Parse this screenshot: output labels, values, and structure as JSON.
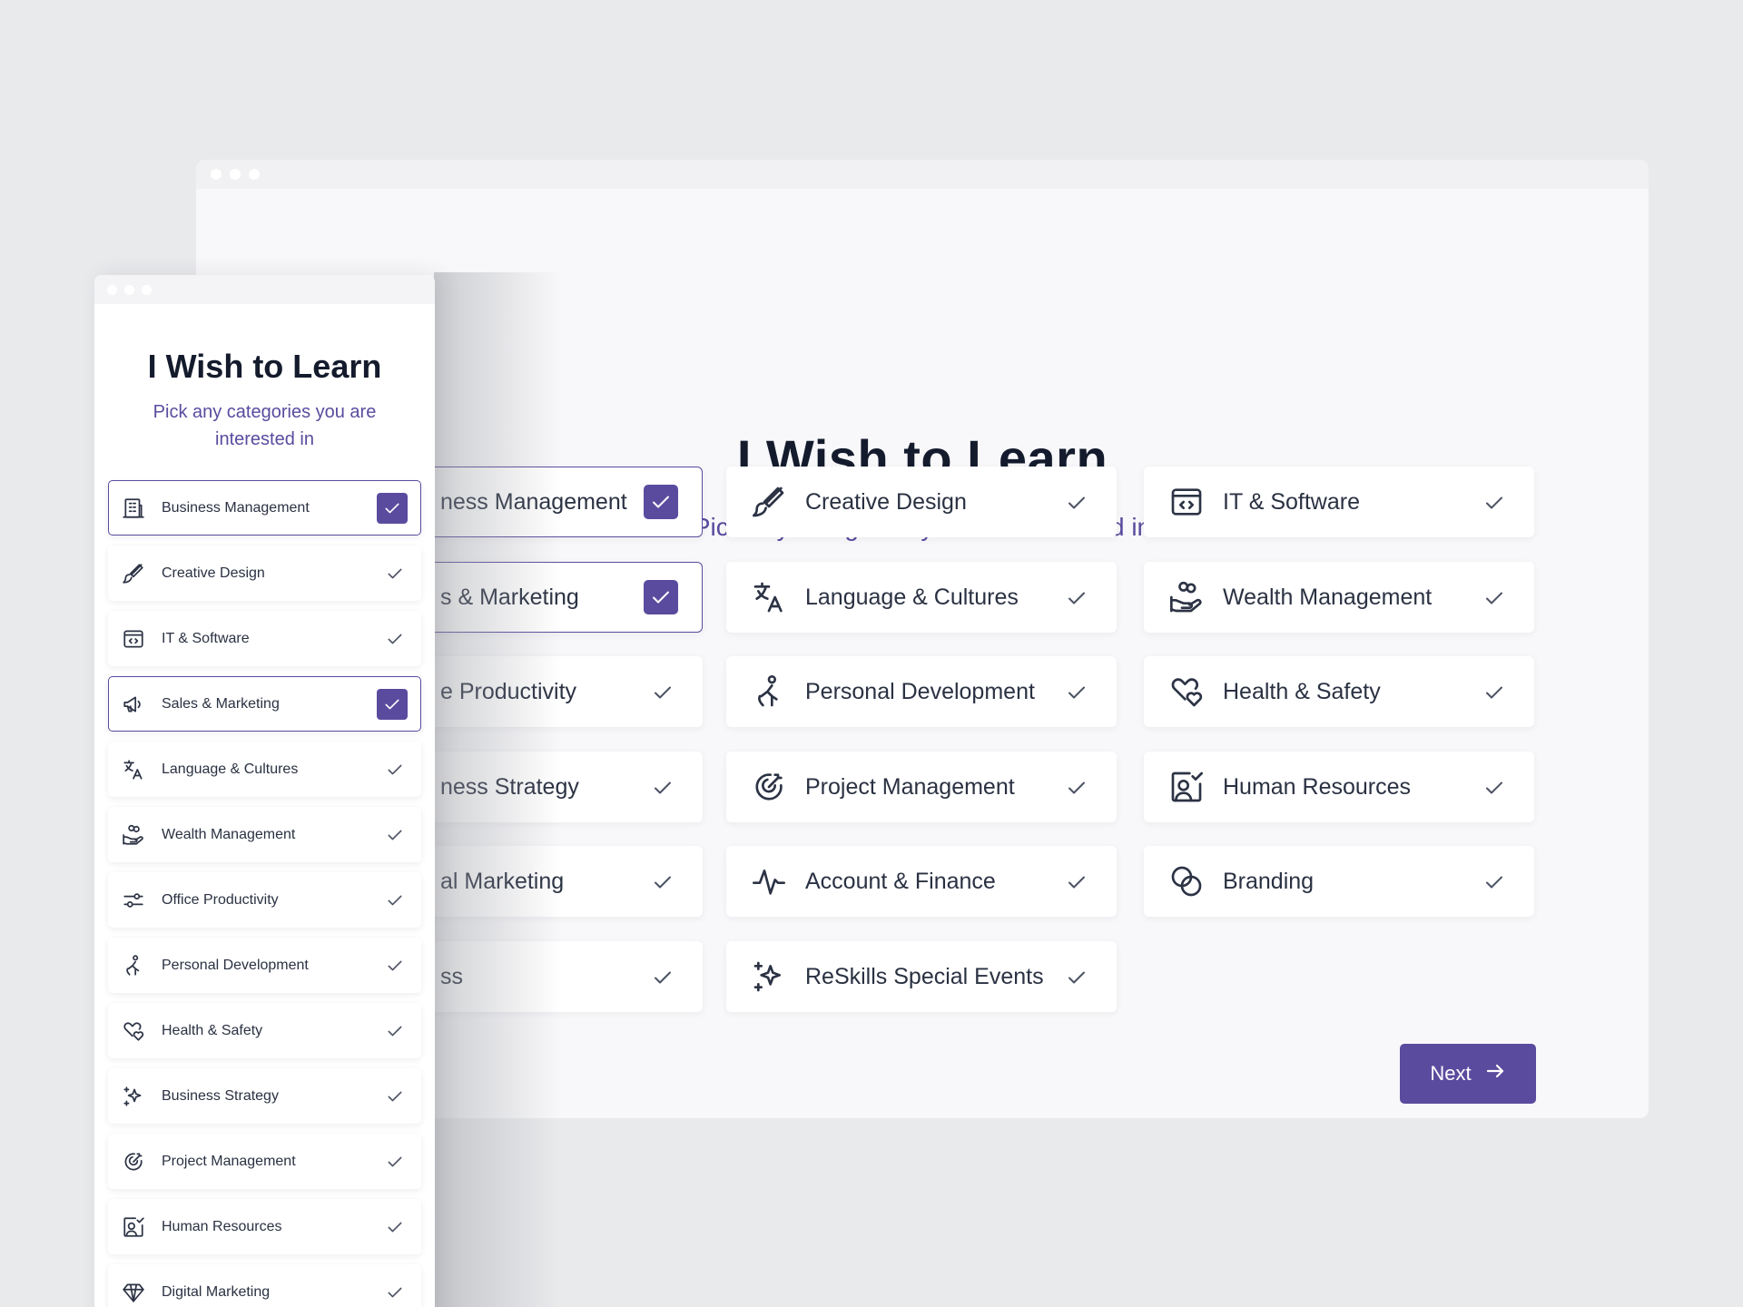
{
  "desktop": {
    "heading": "I Wish to Learn",
    "subheading": "Pick any categories you are interested in",
    "next_label": "Next",
    "columns": [
      [
        {
          "label": "ness Management",
          "icon": "building-icon",
          "selected": true
        },
        {
          "label": "s & Marketing",
          "icon": "megaphone-icon",
          "selected": true
        },
        {
          "label": "e Productivity",
          "icon": "sliders-icon",
          "selected": false
        },
        {
          "label": "ness Strategy",
          "icon": "sparkles-icon",
          "selected": false
        },
        {
          "label": "al Marketing",
          "icon": "diamond-icon",
          "selected": false
        },
        {
          "label": "ss",
          "icon": "briefcase-icon",
          "selected": false
        }
      ],
      [
        {
          "label": "Creative Design",
          "icon": "brush-icon",
          "selected": false
        },
        {
          "label": "Language & Cultures",
          "icon": "translate-icon",
          "selected": false
        },
        {
          "label": "Personal Development",
          "icon": "person-walking-icon",
          "selected": false
        },
        {
          "label": "Project Management",
          "icon": "target-icon",
          "selected": false
        },
        {
          "label": "Account & Finance",
          "icon": "activity-icon",
          "selected": false
        },
        {
          "label": "ReSkills Special Events",
          "icon": "sparkles-icon",
          "selected": false
        }
      ],
      [
        {
          "label": "IT & Software",
          "icon": "code-window-icon",
          "selected": false
        },
        {
          "label": "Wealth Management",
          "icon": "hand-coins-icon",
          "selected": false
        },
        {
          "label": "Health & Safety",
          "icon": "hearts-icon",
          "selected": false
        },
        {
          "label": "Human Resources",
          "icon": "user-check-icon",
          "selected": false
        },
        {
          "label": "Branding",
          "icon": "circles-icon",
          "selected": false
        }
      ]
    ]
  },
  "mobile": {
    "heading": "I Wish to Learn",
    "subheading": "Pick any categories you are interested in",
    "items": [
      {
        "label": "Business Management",
        "icon": "building-icon",
        "selected": true
      },
      {
        "label": "Creative Design",
        "icon": "brush-icon",
        "selected": false
      },
      {
        "label": "IT & Software",
        "icon": "code-window-icon",
        "selected": false
      },
      {
        "label": "Sales & Marketing",
        "icon": "megaphone-icon",
        "selected": true
      },
      {
        "label": "Language & Cultures",
        "icon": "translate-icon",
        "selected": false
      },
      {
        "label": "Wealth Management",
        "icon": "hand-coins-icon",
        "selected": false
      },
      {
        "label": "Office Productivity",
        "icon": "sliders-icon",
        "selected": false
      },
      {
        "label": "Personal Development",
        "icon": "person-walking-icon",
        "selected": false
      },
      {
        "label": "Health & Safety",
        "icon": "hearts-icon",
        "selected": false
      },
      {
        "label": "Business Strategy",
        "icon": "sparkles-icon",
        "selected": false
      },
      {
        "label": "Project Management",
        "icon": "target-icon",
        "selected": false
      },
      {
        "label": "Human Resources",
        "icon": "user-check-icon",
        "selected": false
      },
      {
        "label": "Digital Marketing",
        "icon": "diamond-icon",
        "selected": false
      }
    ]
  },
  "colors": {
    "accent": "#5b4b9e",
    "heading": "#141b2d",
    "subheading": "#5a4b9e",
    "background": "#e9eaec"
  }
}
